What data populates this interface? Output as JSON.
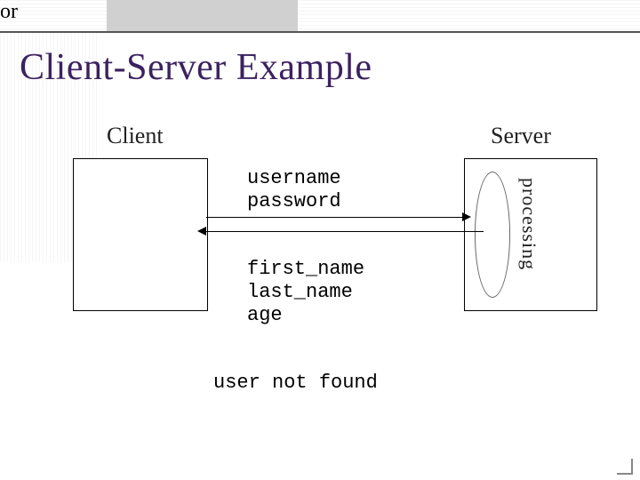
{
  "title": "Client-Server Example",
  "client_label": "Client",
  "server_label": "Server",
  "request": "username\npassword",
  "response": "first_name\nlast_name\nage",
  "alt_word": "or",
  "alt_response": "user not found",
  "processing_label": "processing"
}
